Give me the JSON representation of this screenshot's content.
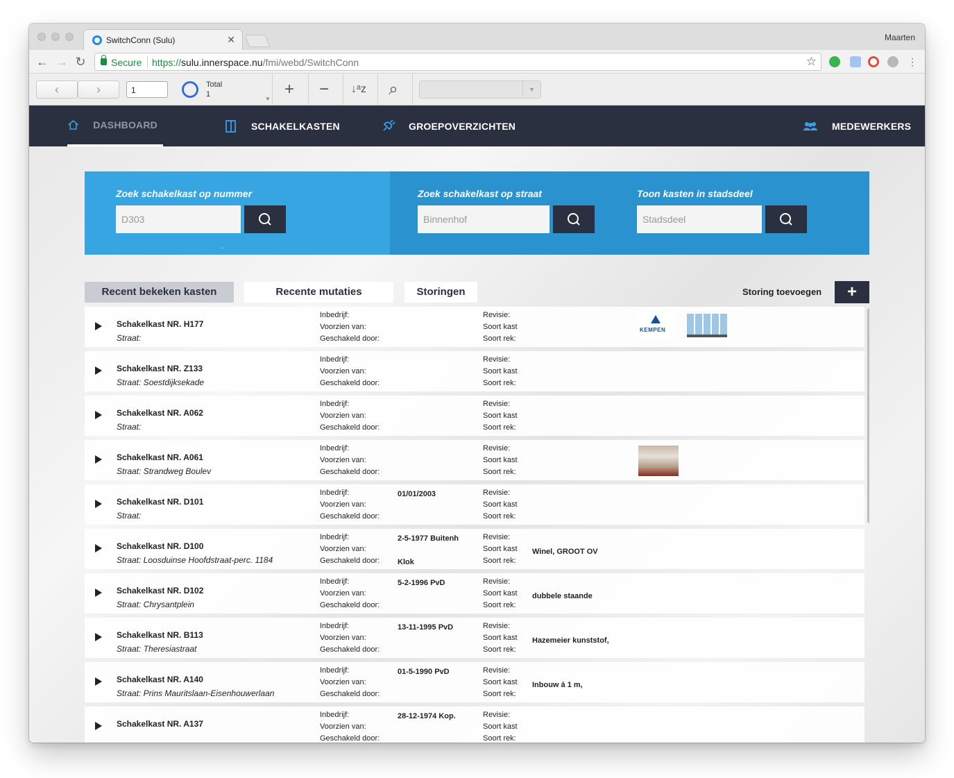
{
  "browser": {
    "tab_title": "SwitchConn (Sulu)",
    "tab_close": "✕",
    "profile_name": "Maarten",
    "secure_label": "Secure",
    "url_proto": "https://",
    "url_host": "sulu.innerspace.nu",
    "url_path": "/fmi/webd/SwitchConn",
    "back_icon": "←",
    "forward_icon": "→",
    "reload_icon": "↻",
    "star_icon": "☆"
  },
  "fm_toolbar": {
    "prev_icon": "‹",
    "next_icon": "›",
    "record_value": "1",
    "total_label": "Total",
    "total_value": "1",
    "new_icon": "+",
    "delete_icon": "−",
    "sort_icon": "↓ᵃz",
    "find_icon": "⌕",
    "dropdown_caret": "▼",
    "pie_caret": "▼"
  },
  "nav": {
    "dashboard": "DASHBOARD",
    "schakelkasten": "SCHAKELKASTEN",
    "groepoverzichten": "GROEPOVERZICHTEN",
    "medewerkers": "MEDEWERKERS",
    "active_color": "#8f98aa",
    "icon_color": "#3aa0e8"
  },
  "search": {
    "nummer_label": "Zoek schakelkast op nummer",
    "nummer_placeholder": "D303",
    "straat_label": "Zoek schakelkast op straat",
    "straat_placeholder": "Binnenhof",
    "stadsdeel_label": "Toon kasten in stadsdeel",
    "stadsdeel_placeholder": "Stadsdeel",
    "dot": "."
  },
  "tabs": {
    "recent": "Recent bekeken kasten",
    "mutaties": "Recente mutaties",
    "storingen": "Storingen",
    "storing_toevoegen": "Storing toevoegen",
    "add_icon": "+"
  },
  "labels": {
    "inbedrijf": "Inbedrijf:",
    "voorzien": "Voorzien van:",
    "geschakeld": "Geschakeld door:",
    "revisie": "Revisie:",
    "soort_kast": "Soort kast",
    "soort_rek": "Soort rek:"
  },
  "logo_text": "KEMPEN",
  "rows": [
    {
      "name": "Schakelkast NR. H177",
      "street": "Straat:",
      "inbedrijf": "",
      "geschakeld": "",
      "soort": ""
    },
    {
      "name": "Schakelkast NR. Z133",
      "street": "Straat: Soestdijksekade",
      "inbedrijf": "",
      "geschakeld": "",
      "soort": ""
    },
    {
      "name": "Schakelkast NR. A062",
      "street": "Straat:",
      "inbedrijf": "",
      "geschakeld": "",
      "soort": ""
    },
    {
      "name": "Schakelkast NR. A061",
      "street": "Straat: Strandweg  Boulev",
      "inbedrijf": "",
      "geschakeld": "",
      "soort": ""
    },
    {
      "name": "Schakelkast NR. D101",
      "street": "Straat:",
      "inbedrijf": "01/01/2003",
      "geschakeld": "",
      "soort": ""
    },
    {
      "name": "Schakelkast NR. D100",
      "street": "Straat: Loosduinse Hoofdstraat-perc. 1184",
      "inbedrijf": "2-5-1977 Buitenh",
      "geschakeld": "Klok",
      "soort": "Winel, GROOT OV"
    },
    {
      "name": "Schakelkast NR. D102",
      "street": "Straat: Chrysantplein",
      "inbedrijf": "5-2-1996 PvD",
      "geschakeld": "",
      "soort": "dubbele staande"
    },
    {
      "name": "Schakelkast NR. B113",
      "street": "Straat: Theresiastraat",
      "inbedrijf": "13-11-1995 PvD",
      "geschakeld": "",
      "soort": "Hazemeier kunststof,"
    },
    {
      "name": "Schakelkast NR. A140",
      "street": "Straat: Prins Mauritslaan-Eisenhouwerlaan",
      "inbedrijf": "01-5-1990 PvD",
      "geschakeld": "",
      "soort": "Inbouw á 1 m,"
    },
    {
      "name": "Schakelkast NR. A137",
      "street": "",
      "inbedrijf": "28-12-1974 Kop.",
      "geschakeld": "",
      "soort": ""
    }
  ]
}
